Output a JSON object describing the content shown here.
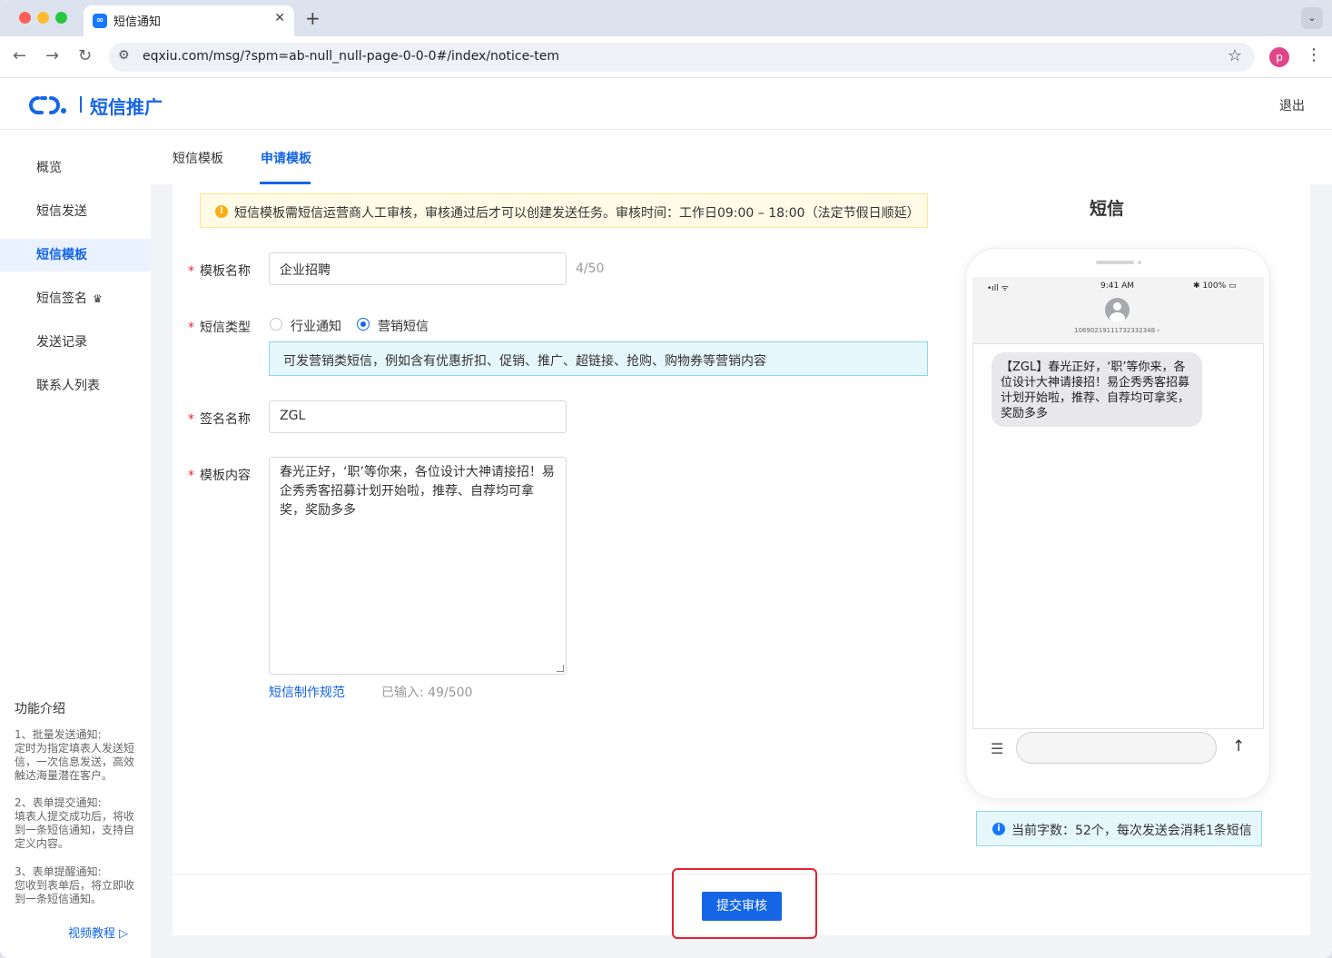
{
  "browser": {
    "tab_title": "短信通知",
    "tab_favicon": "∞",
    "url": "eqxiu.com/msg/?spm=ab-null_null-page-0-0-0#/index/notice-tem",
    "profile_initial": "p"
  },
  "header": {
    "brand": "短信推广",
    "logout": "退出"
  },
  "sidebar": {
    "items": [
      {
        "label": "概览"
      },
      {
        "label": "短信发送"
      },
      {
        "label": "短信模板"
      },
      {
        "label": "短信签名"
      },
      {
        "label": "发送记录"
      },
      {
        "label": "联系人列表"
      }
    ],
    "intro_title": "功能介绍",
    "intro": [
      "1、批量发送通知:\n定时为指定填表人发送短信，一次信息发送，高效触达海量潜在客户。",
      "2、表单提交通知:\n填表人提交成功后，将收到一条短信通知，支持自定义内容。",
      "3、表单提醒通知:\n您收到表单后，将立即收到一条短信通知。"
    ],
    "video_link": "视频教程"
  },
  "tabs": [
    {
      "label": "短信模板"
    },
    {
      "label": "申请模板"
    }
  ],
  "alert": "短信模板需短信运营商人工审核，审核通过后才可以创建发送任务。审核时间：工作日09:00 – 18:00（法定节假日顺延）",
  "form": {
    "name_label": "模板名称",
    "name_value": "企业招聘",
    "name_counter": "4/50",
    "type_label": "短信类型",
    "type_option_1": "行业通知",
    "type_option_2": "营销短信",
    "type_tip": "可发营销类短信，例如含有优惠折扣、促销、推广、超链接、抢购、购物券等营销内容",
    "sign_label": "签名名称",
    "sign_value": "ZGL",
    "content_label": "模板内容",
    "content_value": "春光正好，‘职’等你来，各位设计大神请接招！易企秀秀客招募计划开始啦，推荐、自荐均可拿奖，奖励多多",
    "spec_link": "短信制作规范",
    "input_count": "已输入: 49/500"
  },
  "preview": {
    "title": "短信",
    "status_signal": "•ıll ᯤ",
    "status_time": "9:41 AM",
    "status_battery": "✱ 100% ▭",
    "contact_number": "1069021911173​2332348 ›",
    "bubble": "【ZGL】春光正好，‘职’等你来，各位设计大神请接招！易企秀秀客招募计划开始啦，推荐、自荐均可拿奖，奖励多多",
    "char_count": "当前字数：52个，每次发送会消耗1条短信"
  },
  "submit_label": "提交审核"
}
